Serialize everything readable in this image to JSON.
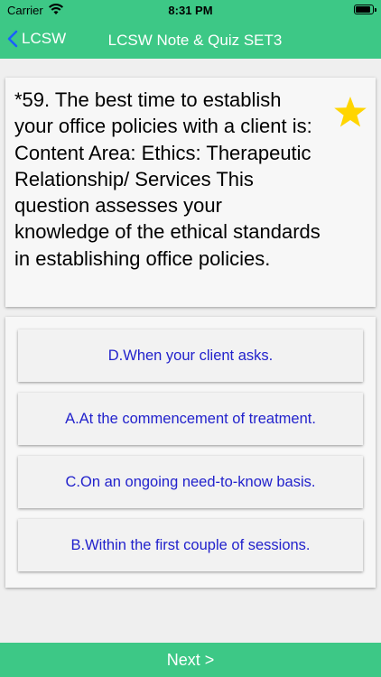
{
  "status_bar": {
    "carrier": "Carrier",
    "time": "8:31 PM",
    "battery_level": 0.9
  },
  "nav": {
    "back_label": "LCSW",
    "title": "LCSW Note & Quiz SET3"
  },
  "question": {
    "text": "*59. The best time to establish your office policies with a client is:   Content Area: Ethics: Therapeutic Relationship/ Services This question assesses your knowledge of the ethical standards in establishing office policies.",
    "starred": true
  },
  "answers": [
    {
      "label": "D.When your client asks."
    },
    {
      "label": "A.At the commencement of treatment."
    },
    {
      "label": "C.On an ongoing need-to-know basis."
    },
    {
      "label": "B.Within the first couple of sessions."
    }
  ],
  "footer": {
    "next_label": "Next >"
  },
  "colors": {
    "accent": "#3dc886",
    "answer_text": "#2222cc",
    "star": "#ffd500"
  }
}
